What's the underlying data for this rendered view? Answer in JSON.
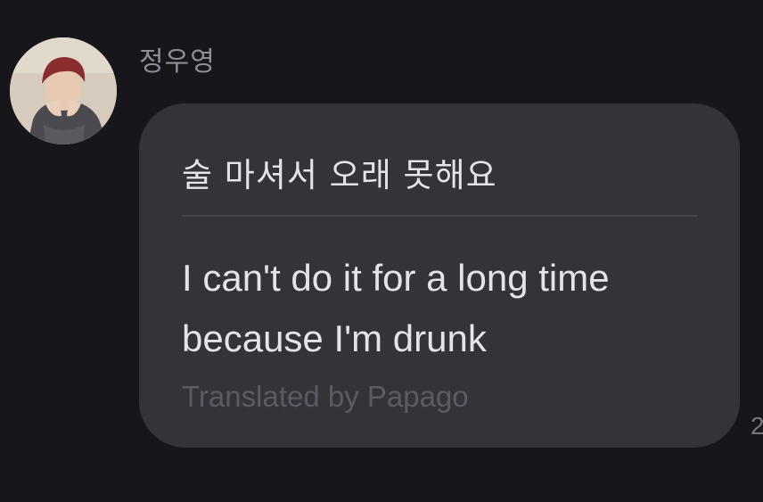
{
  "message": {
    "sender_name": "정우영",
    "avatar_icon": "profile-photo",
    "original_text": "술 마셔서 오래 못해요",
    "translated_text": "I can't do it for a long time because I'm drunk",
    "attribution": "Translated by Papago",
    "timestamp_partial": "2"
  }
}
